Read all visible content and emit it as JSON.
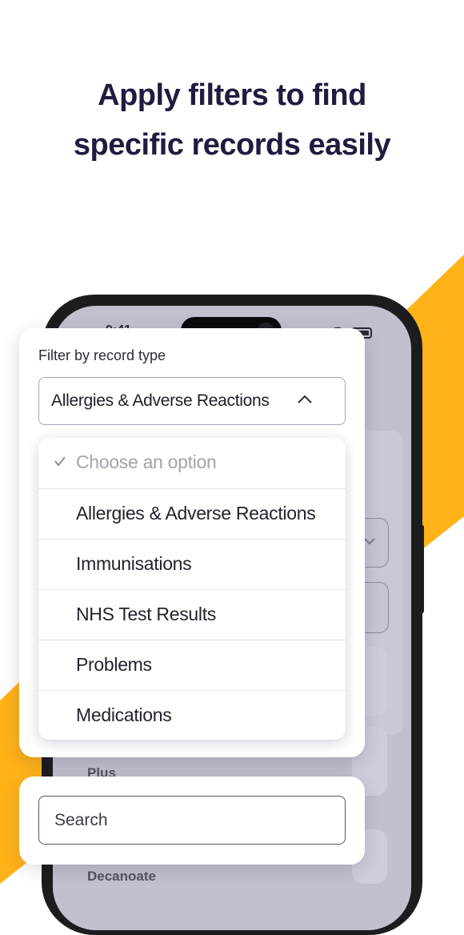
{
  "headline": {
    "line1": "Apply filters to find",
    "line2": "specific records easily"
  },
  "colors": {
    "accent": "#FFB319",
    "heading": "#221B3F",
    "phone_frame": "#1C1C1F",
    "screen_overlay": "#C2BFCF"
  },
  "phone": {
    "status_time": "9:41"
  },
  "background_list": {
    "item_a": "Plus",
    "item_b": "Decanoate"
  },
  "filter": {
    "label": "Filter by record type",
    "selected_value": "Allergies & Adverse Reactions",
    "chevron_icon": "chevron-up-icon",
    "options": [
      {
        "label": "Choose an option",
        "placeholder": true,
        "checked": true
      },
      {
        "label": "Allergies & Adverse Reactions"
      },
      {
        "label": "Immunisations"
      },
      {
        "label": "NHS Test Results"
      },
      {
        "label": "Problems"
      },
      {
        "label": "Medications"
      }
    ]
  },
  "search": {
    "placeholder": "Search"
  }
}
